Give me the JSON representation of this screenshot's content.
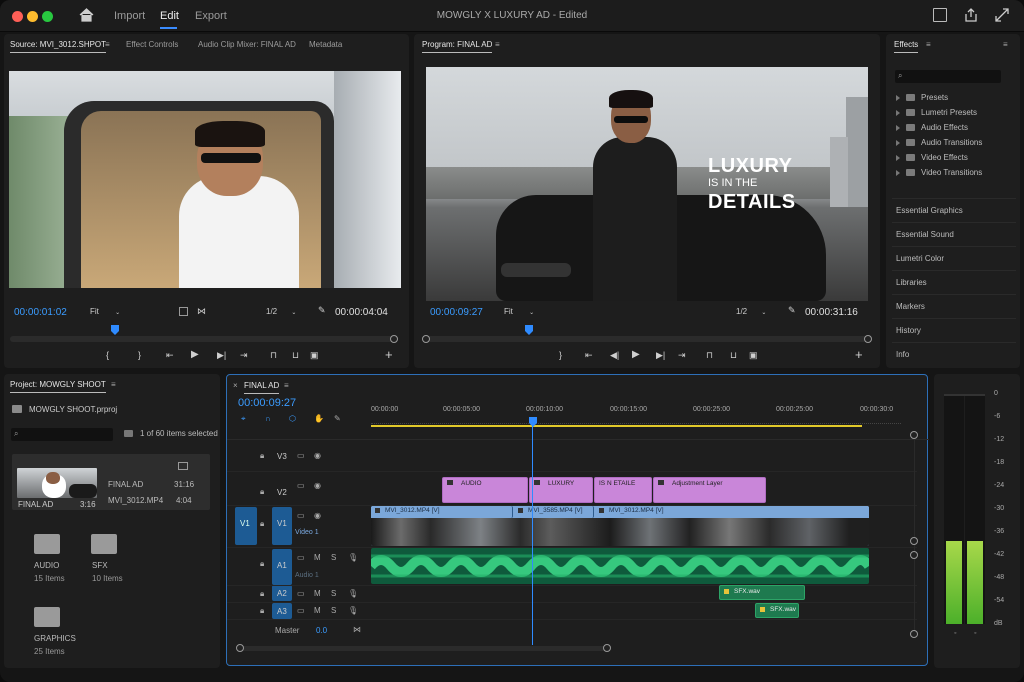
{
  "window": {
    "title": "MOWGLY X LUXURY AD - Edited",
    "menu": [
      "Import",
      "Edit",
      "Export"
    ],
    "active_menu": "Edit"
  },
  "source": {
    "tabs": [
      "Source: MVI_3012.SHPOT",
      "Effect Controls",
      "Audio Clip Mixer: FINAL AD",
      "Metadata"
    ],
    "timecode": "00:00:01:02",
    "fit": "Fit",
    "resolution": "1/2",
    "duration": "00:00:04:04"
  },
  "program": {
    "tab": "Program: FINAL AD",
    "timecode": "00:00:09:27",
    "fit": "Fit",
    "resolution": "1/2",
    "duration": "00:00:31:16",
    "overlay": {
      "line1": "LUXURY",
      "line2": "IS IN THE",
      "line3": "DETAILS"
    }
  },
  "effects": {
    "title": "Effects",
    "folders": [
      "Presets",
      "Lumetri Presets",
      "Audio Effects",
      "Audio Transitions",
      "Video Effects",
      "Video Transitions"
    ],
    "sections": [
      "Essential Graphics",
      "Essential Sound",
      "Lumetri Color",
      "Libraries",
      "Markers",
      "History",
      "Info"
    ]
  },
  "project": {
    "title": "Project: MOWGLY SHOOT",
    "file": "MOWGLY SHOOT.prproj",
    "count": "1 of 60 items selected",
    "items": [
      {
        "name": "FINAL AD",
        "duration": "31:16"
      },
      {
        "name": "MVI_3012.MP4",
        "duration": "4:04"
      }
    ],
    "thumb_name": "FINAL AD",
    "thumb_dur": "3:16",
    "bins": [
      {
        "name": "AUDIO",
        "count": "15 Items"
      },
      {
        "name": "SFX",
        "count": "10 Items"
      },
      {
        "name": "GRAPHICS",
        "count": "25 Items"
      }
    ]
  },
  "timeline": {
    "tab": "FINAL AD",
    "timecode": "00:00:09:27",
    "ruler": [
      "00:00:00",
      "00:00:05:00",
      "00:00:10:00",
      "00:00:15:00",
      "00:00:25:00",
      "00:00:25:00",
      "00:00:30:0"
    ],
    "tracks": {
      "v3": "V3",
      "v2": "V2",
      "v1": "V1",
      "v1src": "V1",
      "a1": "A1",
      "a2": "A2",
      "a3": "A3",
      "master": "Master",
      "master_val": "0.0",
      "m": "M",
      "s": "S",
      "v1_sub": "Video 1",
      "a1_sub": "Audio 1"
    },
    "v2_clips": [
      "AUDIO",
      "LUXURY",
      "IS N ETAILE",
      "Adjustment Layer"
    ],
    "v1_clips": [
      "MVI_3012.MP4 [V]",
      "MVI_3585.MP4 [V]",
      "MVI_3012.MP4 [V]"
    ],
    "sfx_clips": [
      "SFX.wav",
      "SFX.wav"
    ]
  },
  "meter": {
    "scale": [
      "0",
      "-6",
      "-12",
      "-18",
      "-24",
      "-30",
      "-36",
      "-42",
      "-48",
      "-54",
      "dB"
    ],
    "level_db": -36
  }
}
